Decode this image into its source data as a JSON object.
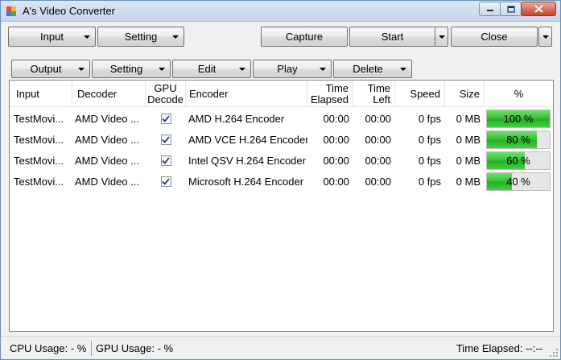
{
  "window": {
    "title": "A's Video Converter",
    "buttons": [
      "minimize-icon",
      "maximize-icon",
      "close-icon"
    ]
  },
  "toolbar": {
    "input": "Input",
    "setting": "Setting",
    "capture": "Capture",
    "start": "Start",
    "close": "Close"
  },
  "toolbar2": {
    "output": "Output",
    "setting": "Setting",
    "edit": "Edit",
    "play": "Play",
    "delete": "Delete"
  },
  "table": {
    "columns": {
      "input": "Input",
      "decoder": "Decoder",
      "gpu_decode_1": "GPU",
      "gpu_decode_2": "Decode",
      "encoder": "Encoder",
      "time_elapsed_1": "Time",
      "time_elapsed_2": "Elapsed",
      "time_left_1": "Time",
      "time_left_2": "Left",
      "speed": "Speed",
      "size": "Size",
      "percent": "%"
    },
    "rows": [
      {
        "input": "TestMovi...",
        "decoder": "AMD Video ...",
        "gpu": true,
        "encoder": "AMD H.264 Encoder",
        "elapsed": "00:00",
        "left": "00:00",
        "speed": "0 fps",
        "size": "0 MB",
        "progress": 100,
        "progress_label": "100 %"
      },
      {
        "input": "TestMovi...",
        "decoder": "AMD Video ...",
        "gpu": true,
        "encoder": "AMD VCE H.264 Encoder",
        "elapsed": "00:00",
        "left": "00:00",
        "speed": "0 fps",
        "size": "0 MB",
        "progress": 80,
        "progress_label": "80 %"
      },
      {
        "input": "TestMovi...",
        "decoder": "AMD Video ...",
        "gpu": true,
        "encoder": "Intel QSV H.264 Encoder",
        "elapsed": "00:00",
        "left": "00:00",
        "speed": "0 fps",
        "size": "0 MB",
        "progress": 60,
        "progress_label": "60 %"
      },
      {
        "input": "TestMovi...",
        "decoder": "AMD Video ...",
        "gpu": true,
        "encoder": "Microsoft H.264 Encoder",
        "elapsed": "00:00",
        "left": "00:00",
        "speed": "0 fps",
        "size": "0 MB",
        "progress": 40,
        "progress_label": "40 %"
      }
    ]
  },
  "status": {
    "cpu": "CPU Usage: - %",
    "gpu": "GPU Usage: - %",
    "elapsed": "Time Elapsed: --:--"
  },
  "colors": {
    "progress_fill": "#37c237",
    "titlebar": "#c6d6ea"
  }
}
